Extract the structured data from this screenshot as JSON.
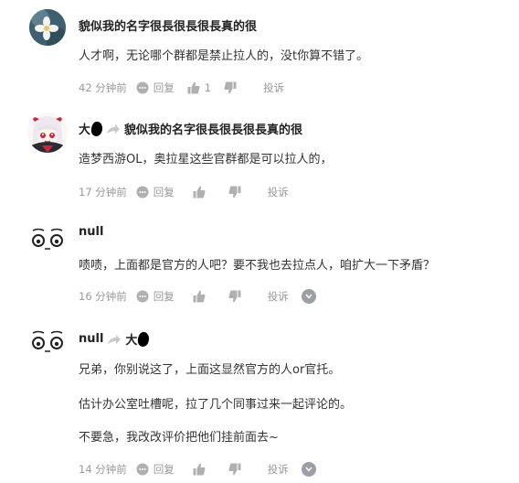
{
  "comments": [
    {
      "username": "貌似我的名字很長很長很長真的很",
      "text": "人才啊，无论哪个群都是禁止拉人的，没t你算不错了。",
      "time": "42 分钟前",
      "reply": "回复",
      "likes": "1",
      "report": "投诉"
    },
    {
      "username": "大",
      "reply_to": "貌似我的名字很長很長很長真的很",
      "text": "造梦西游OL，奥拉星这些官群都是可以拉人的，",
      "time": "17 分钟前",
      "reply": "回复",
      "report": "投诉"
    },
    {
      "username": "null",
      "text": "啧啧，上面都是官方的人吧？要不我也去拉点人，咱扩大一下矛盾？",
      "time": "16 分钟前",
      "reply": "回复",
      "report": "投诉"
    },
    {
      "username": "null",
      "reply_to": "大",
      "lines": [
        "兄弟，你别说这了，上面这显然官方的人or官托。",
        "估计办公室吐槽呢，拉了几个同事过来一起评论的。",
        "不要急，我改改评价把他们挂前面去~"
      ],
      "time": "14 分钟前",
      "reply": "回复",
      "report": "投诉"
    }
  ],
  "colors": {
    "meta": "#999999",
    "text": "#333333",
    "name": "#222222",
    "icon": "#b0b0b0"
  },
  "icons": [
    "comment-icon",
    "thumbs-up-icon",
    "thumbs-down-icon",
    "more-icon",
    "reply-arrow-icon"
  ]
}
